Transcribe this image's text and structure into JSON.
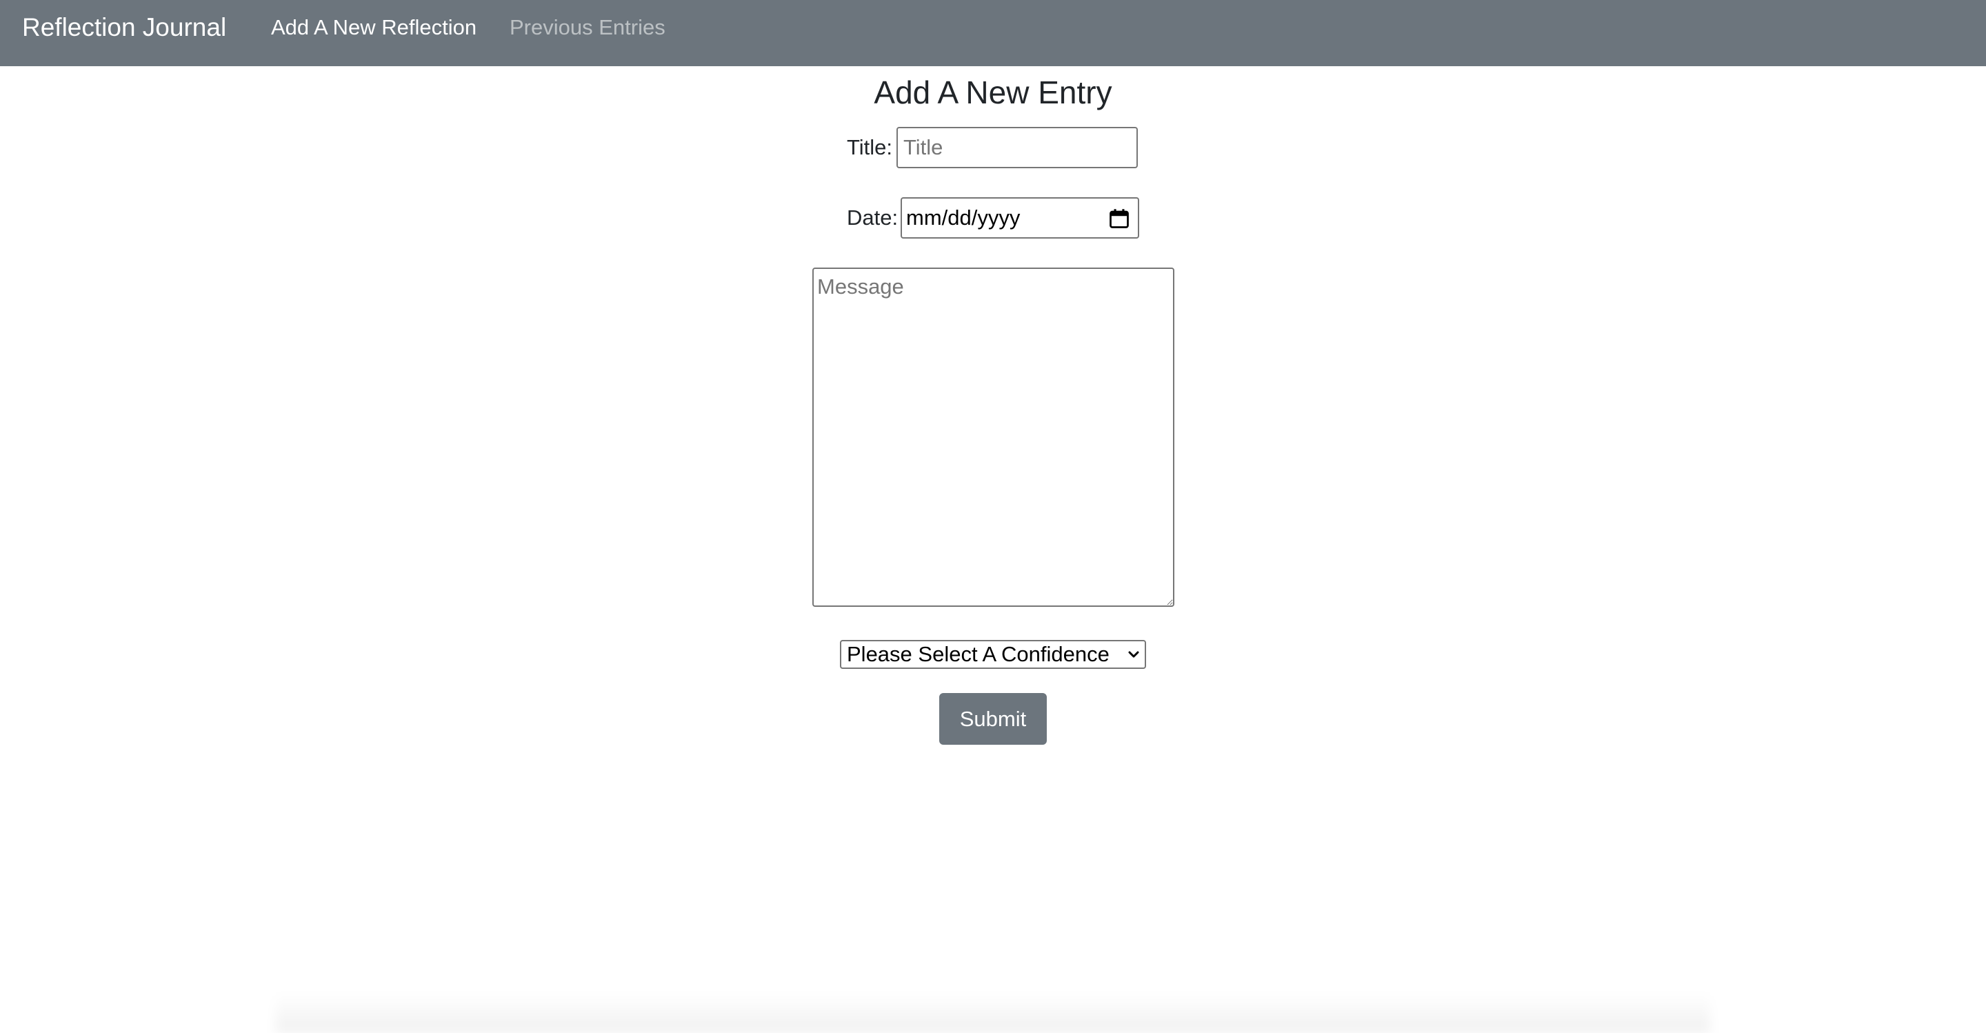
{
  "navbar": {
    "brand": "Reflection Journal",
    "links": [
      {
        "label": "Add A New Reflection",
        "active": true
      },
      {
        "label": "Previous Entries",
        "active": false
      }
    ],
    "background": "#6c757d"
  },
  "form": {
    "heading": "Add A New Entry",
    "title_label": "Title:",
    "title_placeholder": "Title",
    "date_label": "Date:",
    "date_value": "mm/dd/yyyy",
    "message_placeholder": "Message",
    "confidence_selected": "Please Select A Confidence",
    "submit_label": "Submit"
  },
  "icons": {
    "date_picker": "calendar-icon",
    "select": "chevron-down-icon"
  }
}
